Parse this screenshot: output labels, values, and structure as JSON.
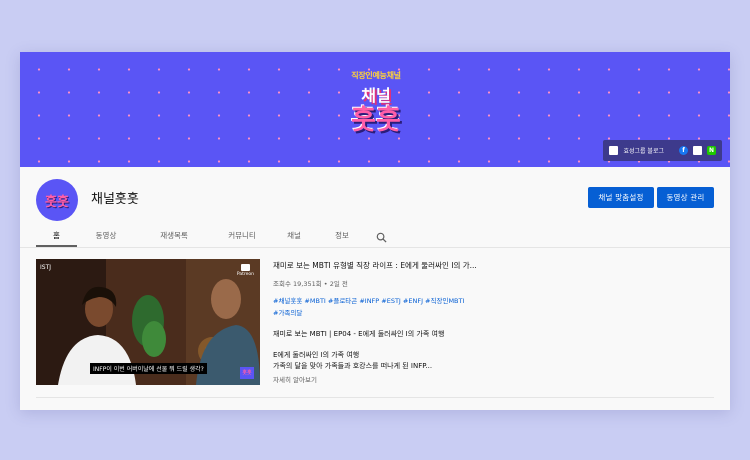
{
  "banner": {
    "logo_top": "직장인예능채널",
    "logo_mid": "채널",
    "logo_big": "훗훗",
    "link_text": "효성그룹 블로그",
    "fb_icon": "f",
    "nv_icon": "N"
  },
  "channel": {
    "avatar_text": "훗훗",
    "name": "채널훗훗",
    "customize_label": "채널 맞춤설정",
    "manage_label": "동영상 관리"
  },
  "tabs": [
    {
      "label": "홈"
    },
    {
      "label": "동영상"
    },
    {
      "label": "재생목록"
    },
    {
      "label": "커뮤니티"
    },
    {
      "label": "채널"
    },
    {
      "label": "정보"
    }
  ],
  "video": {
    "thumb_label": "ISTJ",
    "thumb_brand": "Patreon",
    "subtitle": "INFP이 이번 어버이날에 선물 뭐 드릴 생각?",
    "mini_logo": "훗훗",
    "title": "재미로 보는 MBTI 유형별 직장 라이프 : E에게 둘러싸인 I의 가...",
    "meta": "조회수 19,351회 • 2일 전",
    "tags_line1": "#채널훗훗 #MBTI #플로타곤 #INFP #ESTJ #ENFJ #직장인MBTI",
    "tags_line2": "#가족의달",
    "desc_title": "재미로 보는 MBTI | EP04 - E에게 둘러싸인 I의 가족 여행",
    "desc_line1": "E에게 둘러싸인 I의 가족 여행",
    "desc_line2": "가족의 달을 맞아 가족들과 호캉스를 떠나게 된 INFP...",
    "more": "자세히 알아보기"
  },
  "colors": {
    "banner": "#5a55f5",
    "accent_pink": "#ff5ea8",
    "button_blue": "#065fd4",
    "tag_blue": "#065fd4",
    "page_bg": "#c9cdf3"
  }
}
